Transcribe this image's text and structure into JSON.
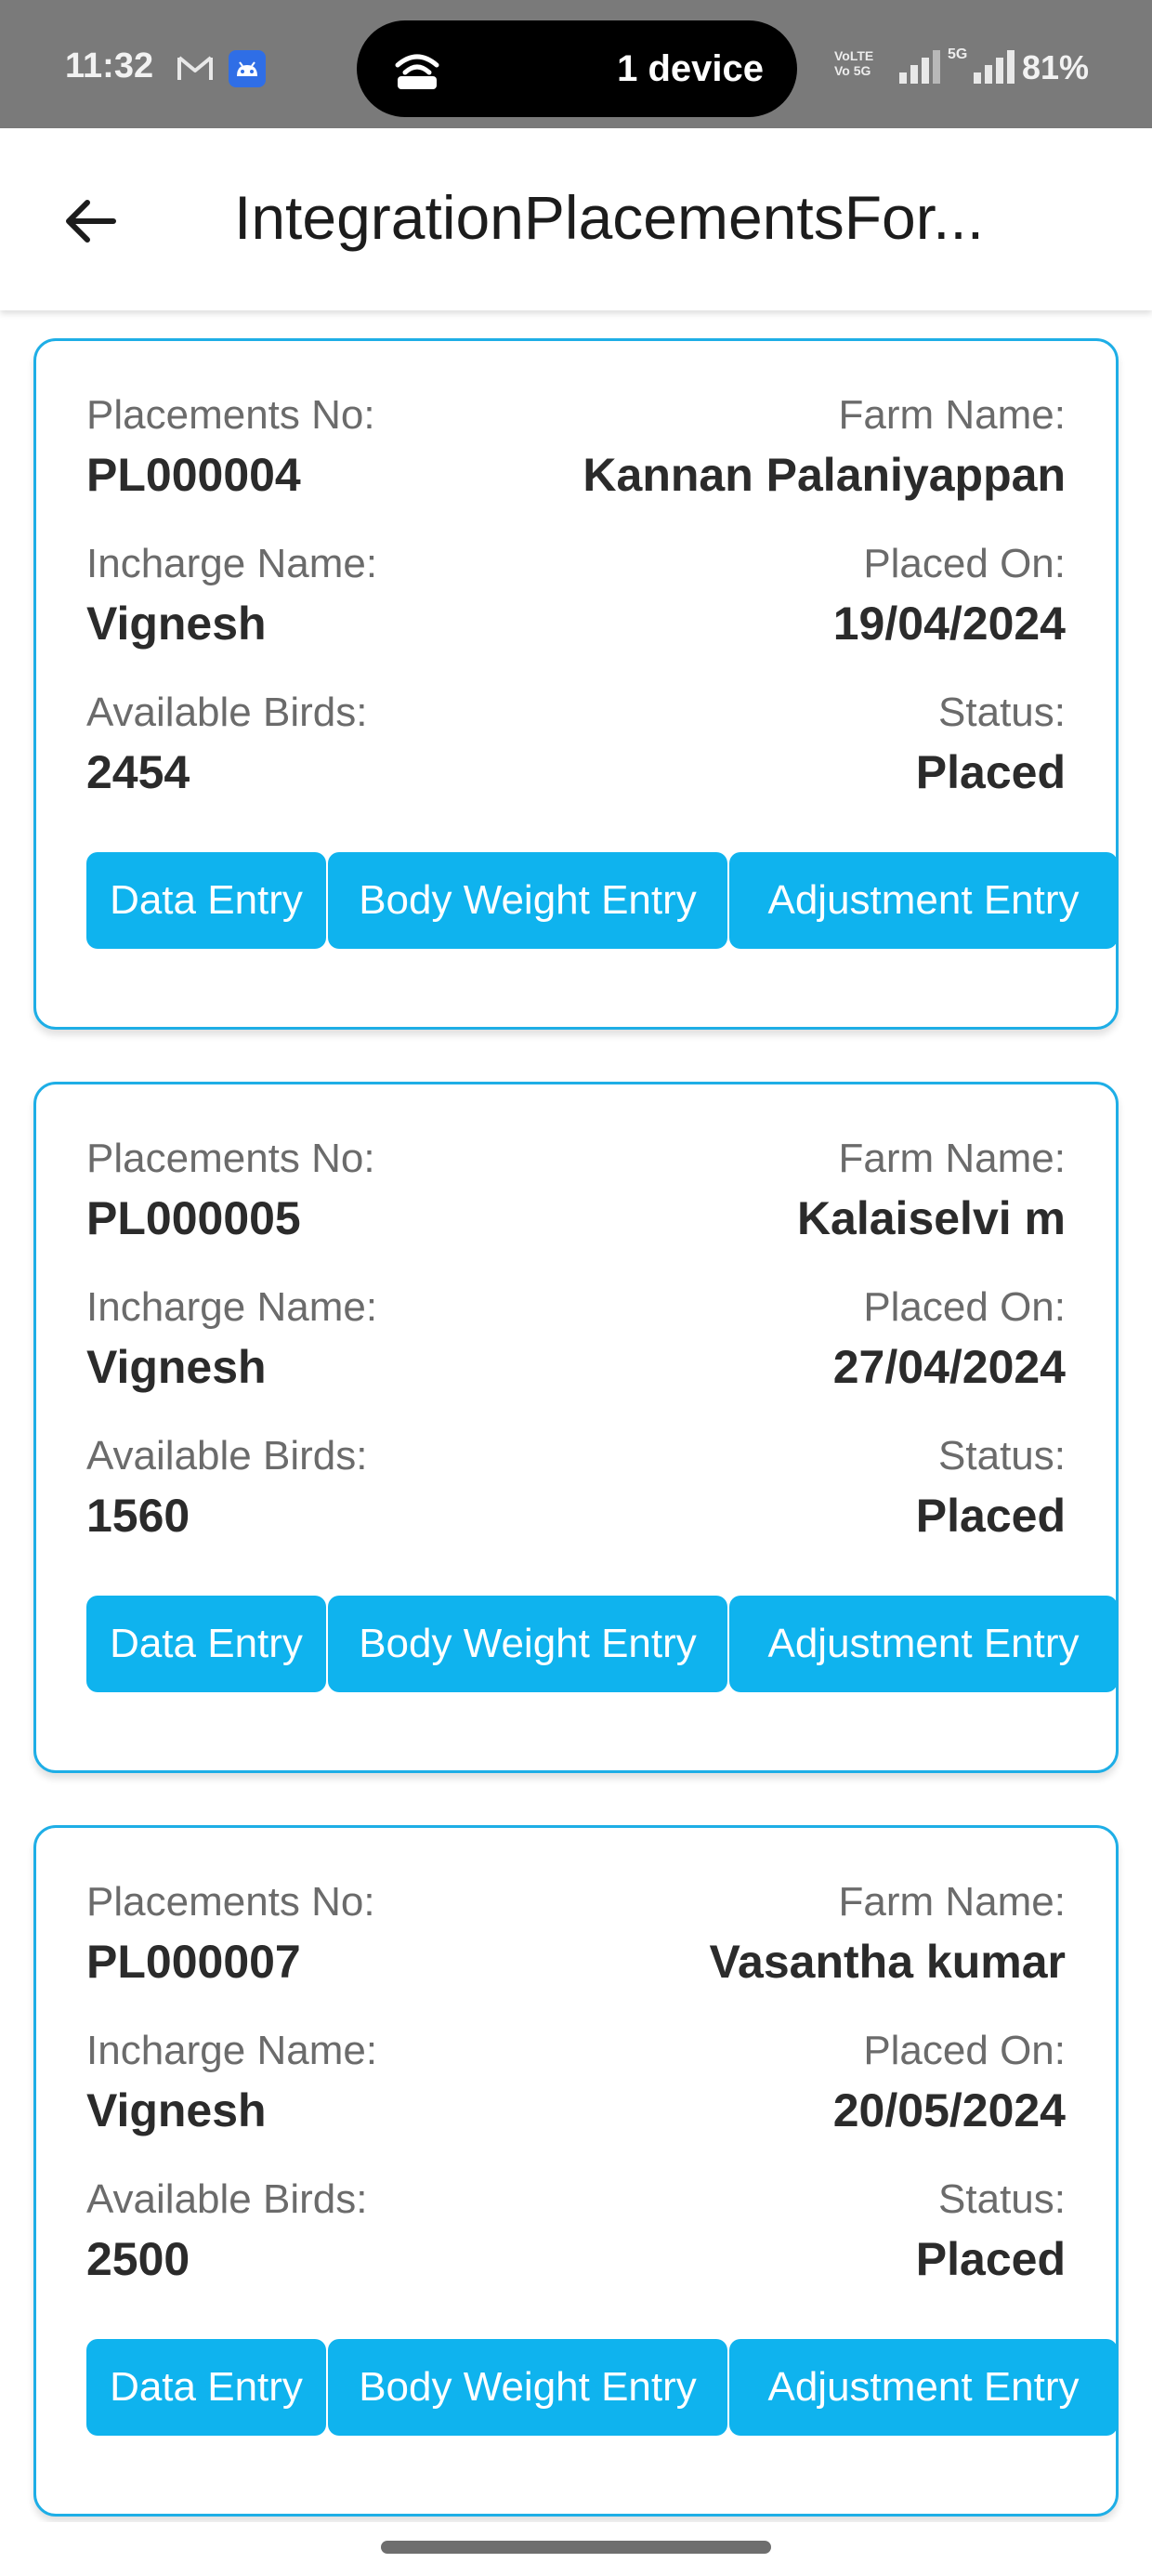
{
  "status_bar": {
    "time": "11:32",
    "hotspot_text": "1 device",
    "volte_line1": "VoLTE",
    "volte_line2": "Vo 5G",
    "network": "5G",
    "battery": "81%"
  },
  "app_bar": {
    "title": "IntegrationPlacementsFor..."
  },
  "labels": {
    "placement_no": "Placements No:",
    "farm_name": "Farm Name:",
    "incharge_name": "Incharge Name:",
    "placed_on": "Placed On:",
    "available_birds": "Available Birds:",
    "status": "Status:"
  },
  "buttons": {
    "data_entry": "Data Entry",
    "body_weight_entry": "Body Weight Entry",
    "adjustment_entry": "Adjustment Entry"
  },
  "placements": [
    {
      "placement_no": "PL000004",
      "farm_name": "Kannan Palaniyappan",
      "incharge_name": "Vignesh",
      "placed_on": "19/04/2024",
      "available_birds": "2454",
      "status": "Placed"
    },
    {
      "placement_no": "PL000005",
      "farm_name": "Kalaiselvi m",
      "incharge_name": "Vignesh",
      "placed_on": "27/04/2024",
      "available_birds": "1560",
      "status": "Placed"
    },
    {
      "placement_no": "PL000007",
      "farm_name": "Vasantha kumar",
      "incharge_name": "Vignesh",
      "placed_on": "20/05/2024",
      "available_birds": "2500",
      "status": "Placed"
    }
  ],
  "colors": {
    "accent": "#0fb3ee",
    "card_border": "#1eaee6",
    "status_bar": "#7a7a7a"
  },
  "icons": {
    "back": "arrow-left-icon",
    "hotspot": "hotspot-icon",
    "gmail": "gmail-icon",
    "android": "android-icon"
  }
}
